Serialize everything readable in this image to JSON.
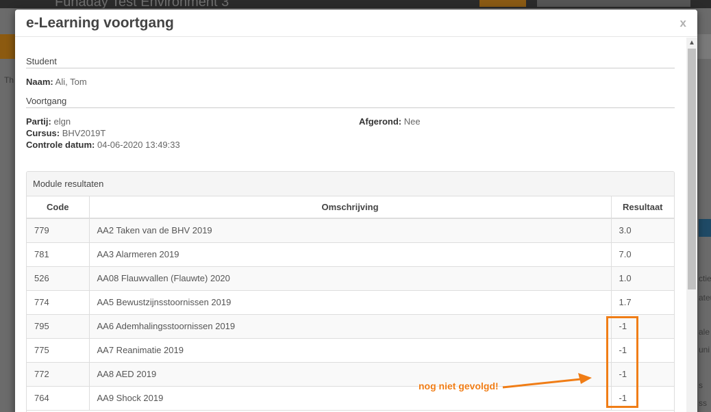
{
  "background": {
    "app_title": "Funaday Test Environment 3",
    "left_tab_text": "Th",
    "right_fragments": [
      "ctie",
      "ateu",
      "ale",
      "uni",
      "s",
      "ss"
    ]
  },
  "modal": {
    "title": "e-Learning voortgang",
    "close_label": "x",
    "student_section": "Student",
    "name_label": "Naam:",
    "name_value": "Ali, Tom",
    "progress_section": "Voortgang",
    "party_label": "Partij:",
    "party_value": "elgn",
    "course_label": "Cursus:",
    "course_value": "BHV2019T",
    "check_date_label": "Controle datum:",
    "check_date_value": "04-06-2020 13:49:33",
    "completed_label": "Afgerond:",
    "completed_value": "Nee",
    "panel_title": "Module resultaten",
    "columns": {
      "code": "Code",
      "description": "Omschrijving",
      "result": "Resultaat"
    },
    "rows": [
      {
        "code": "779",
        "description": "AA2 Taken van de BHV 2019",
        "result": "3.0"
      },
      {
        "code": "781",
        "description": "AA3 Alarmeren 2019",
        "result": "7.0"
      },
      {
        "code": "526",
        "description": "AA08 Flauwvallen (Flauwte) 2020",
        "result": "1.0"
      },
      {
        "code": "774",
        "description": "AA5 Bewustzijnsstoornissen 2019",
        "result": "1.7"
      },
      {
        "code": "795",
        "description": "AA6 Ademhalingsstoornissen 2019",
        "result": "-1"
      },
      {
        "code": "775",
        "description": "AA7 Reanimatie 2019",
        "result": "-1"
      },
      {
        "code": "772",
        "description": "AA8 AED 2019",
        "result": "-1"
      },
      {
        "code": "764",
        "description": "AA9 Shock 2019",
        "result": "-1"
      }
    ]
  },
  "annotation": {
    "text": "nog niet gevolgd!",
    "color": "#f07d16"
  }
}
